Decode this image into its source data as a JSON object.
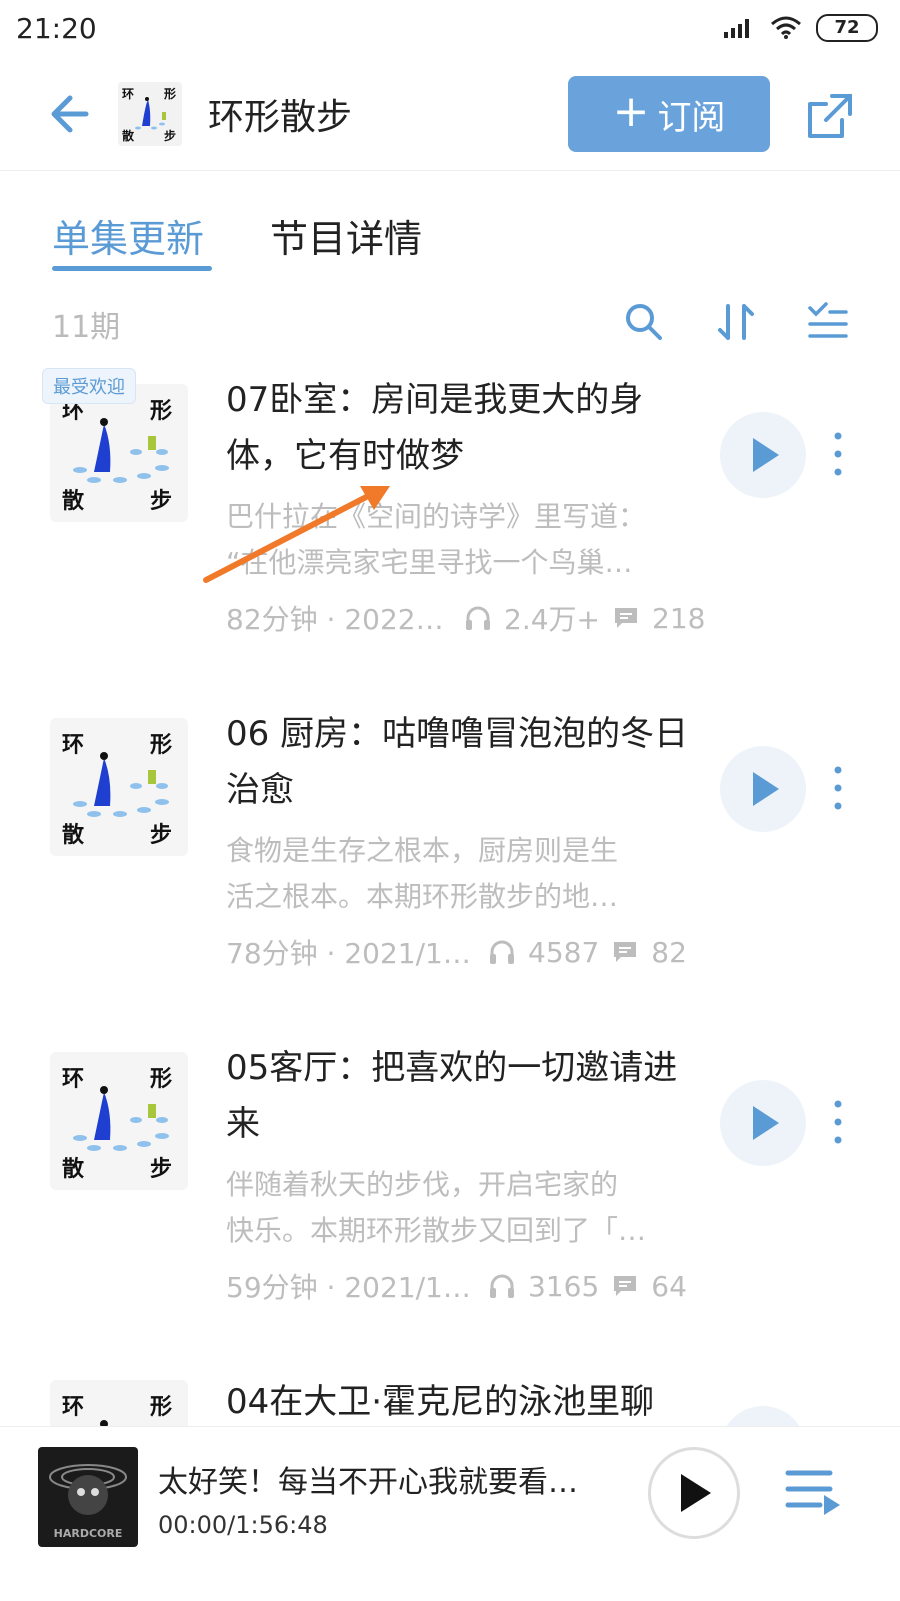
{
  "status_bar": {
    "time": "21:20",
    "battery": "72"
  },
  "header": {
    "title": "环形散步",
    "subscribe_label": "订阅",
    "cover_chars": [
      "环",
      "形",
      "散",
      "步"
    ]
  },
  "tabs": [
    {
      "label": "单集更新",
      "active": true
    },
    {
      "label": "节目详情",
      "active": false
    }
  ],
  "list": {
    "count": "11期"
  },
  "episodes": [
    {
      "badge": "最受欢迎",
      "title": "07卧室：房间是我更大的身体，它有时做梦",
      "desc_line1": "巴什拉在《空间的诗学》里写道：",
      "desc_line2": "“在他漂亮家宅里寻找一个鸟巢…",
      "duration_date": "82分钟 · 2022…",
      "listens": "2.4万+",
      "comments": "218"
    },
    {
      "badge": "",
      "title": "06 厨房：咕噜噜冒泡泡的冬日治愈",
      "desc_line1": "食物是生存之根本，厨房则是生",
      "desc_line2": "活之根本。本期环形散步的地…",
      "duration_date": "78分钟 · 2021/1…",
      "listens": "4587",
      "comments": "82"
    },
    {
      "badge": "",
      "title": "05客厅：把喜欢的一切邀请进来",
      "desc_line1": "伴随着秋天的步伐，开启宅家的",
      "desc_line2": "快乐。本期环形散步又回到了「…",
      "duration_date": "59分钟 · 2021/1…",
      "listens": "3165",
      "comments": "64"
    },
    {
      "badge": "",
      "title": "04在大卫·霍克尼的泳池里聊",
      "desc_line1": "",
      "desc_line2": "",
      "duration_date": "",
      "listens": "",
      "comments": ""
    }
  ],
  "player": {
    "title": "太好笑！每当不开心我就要看…",
    "time": "00:00/1:56:48",
    "cover_text": "HARDCORE"
  },
  "colors": {
    "accent": "#5b9bd5",
    "subscribe": "#6aa3dc",
    "annotation_arrow": "#f07a2a"
  }
}
